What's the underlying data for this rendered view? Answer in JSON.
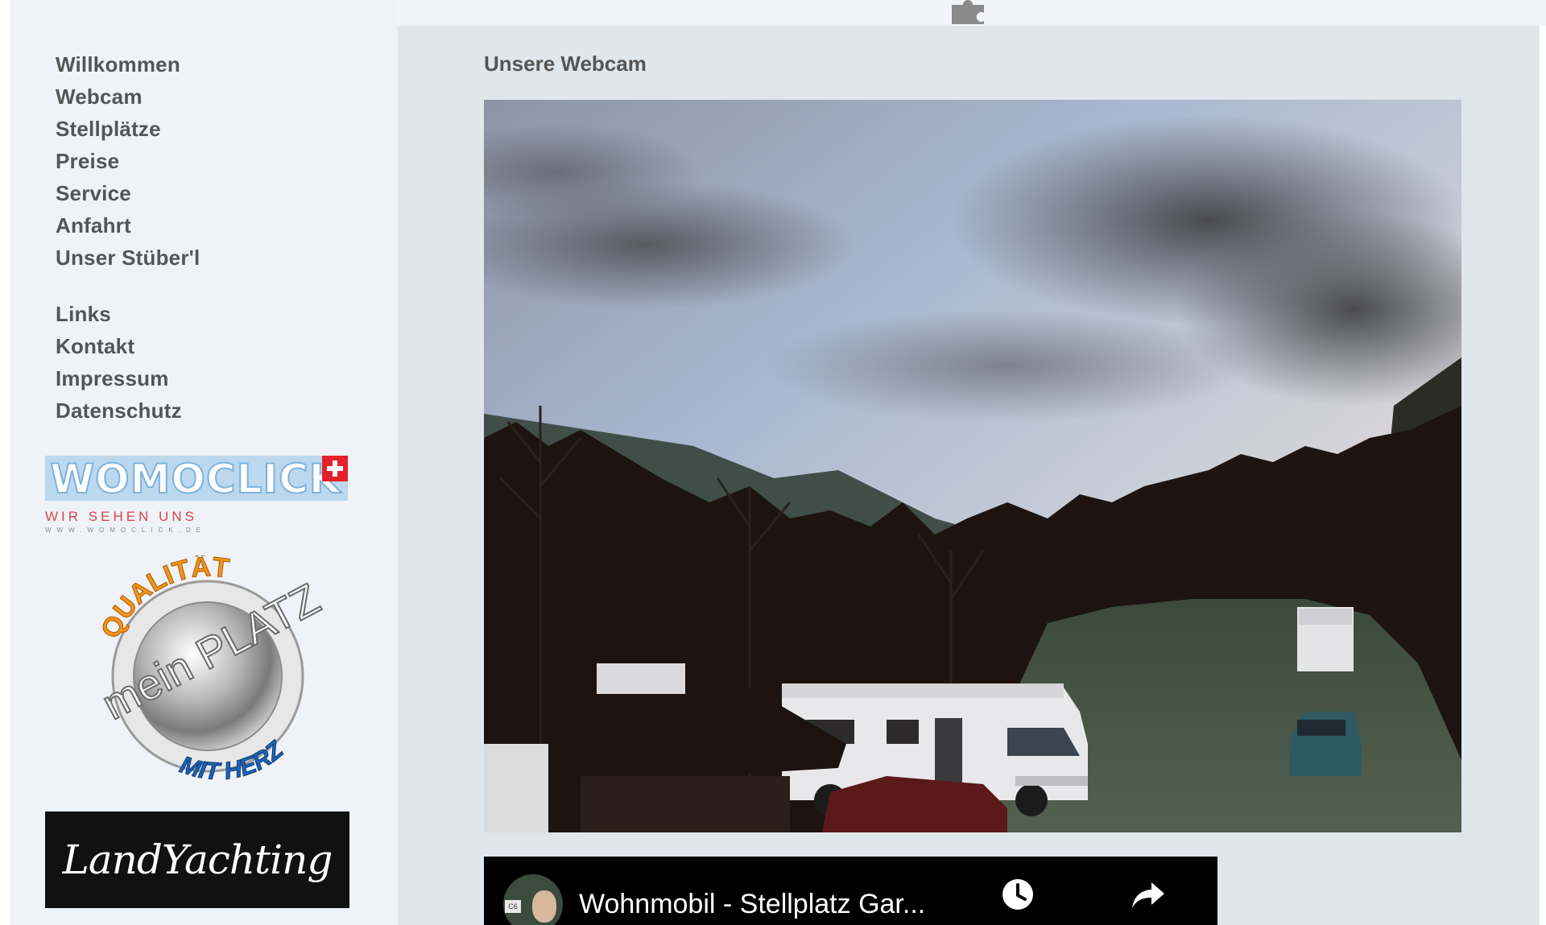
{
  "sidebar": {
    "nav_primary": [
      "Willkommen",
      "Webcam",
      "Stellplätze",
      "Preise",
      "Service",
      "Anfahrt",
      "Unser Stüber'l"
    ],
    "nav_secondary": [
      "Links",
      "Kontakt",
      "Impressum",
      "Datenschutz"
    ],
    "logos": {
      "womoclick": {
        "name": "WOMOCLICK",
        "tagline": "WIR SEHEN UNS",
        "url": "WWW.WOMOCLICK.DE"
      },
      "seal": {
        "top_text": "QUALITÄT",
        "center_text": "mein PLATZ",
        "bottom_text": "MIT HERZ"
      },
      "landyachting": {
        "text": "LandYachting"
      }
    }
  },
  "main": {
    "title": "Unsere Webcam",
    "video": {
      "title": "Wohnmobil - Stellplatz Gar...",
      "channel_sign": "C6",
      "icons": [
        "clock-icon",
        "share-icon"
      ]
    }
  },
  "colors": {
    "sidebar_bg": "#eff2f7",
    "main_bg": "#dfe6ec",
    "text": "#555555"
  }
}
